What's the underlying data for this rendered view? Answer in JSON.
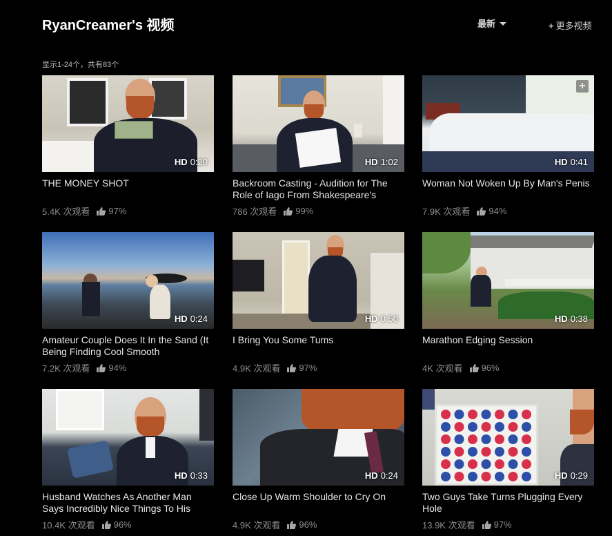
{
  "header": {
    "title": "RyanCreamer's 视频",
    "sort_label": "最新",
    "more_plus": "+",
    "more_label": "更多视频"
  },
  "count_text": "显示1-24个，共有83个",
  "colors": {
    "background": "#000000",
    "meta_text": "#8c8c8c",
    "title_text": "#e6e6e6"
  },
  "icons": {
    "thumbs_up": "thumbs-up-icon",
    "add": "add-to-playlist-icon",
    "sort_caret": "caret-down-icon"
  },
  "videos": [
    {
      "title": "THE MONEY SHOT",
      "hd": "HD",
      "duration": "0:20",
      "views": "5.4K 次观看",
      "rating": "97%"
    },
    {
      "title": "Backroom Casting - Audition for The Role of Iago From Shakespeare's",
      "hd": "HD",
      "duration": "1:02",
      "views": "786 次观看",
      "rating": "99%"
    },
    {
      "title": "Woman Not Woken Up By Man's Penis",
      "hd": "HD",
      "duration": "0:41",
      "views": "7.9K 次观看",
      "rating": "94%"
    },
    {
      "title": "Amateur Couple Does It In the Sand (It Being Finding Cool Smooth",
      "hd": "HD",
      "duration": "0:24",
      "views": "7.2K 次观看",
      "rating": "94%"
    },
    {
      "title": "I Bring You Some Tums",
      "hd": "HD",
      "duration": "0:50",
      "views": "4.9K 次观看",
      "rating": "97%"
    },
    {
      "title": "Marathon Edging Session",
      "hd": "HD",
      "duration": "0:38",
      "views": "4K 次观看",
      "rating": "96%"
    },
    {
      "title": "Husband Watches As Another Man Says Incredibly Nice Things To His",
      "hd": "HD",
      "duration": "0:33",
      "views": "10.4K 次观看",
      "rating": "96%"
    },
    {
      "title": "Close Up Warm Shoulder to Cry On",
      "hd": "HD",
      "duration": "0:24",
      "views": "4.9K 次观看",
      "rating": "96%"
    },
    {
      "title": "Two Guys Take Turns Plugging Every Hole",
      "hd": "HD",
      "duration": "0:29",
      "views": "13.9K 次观看",
      "rating": "97%"
    }
  ]
}
